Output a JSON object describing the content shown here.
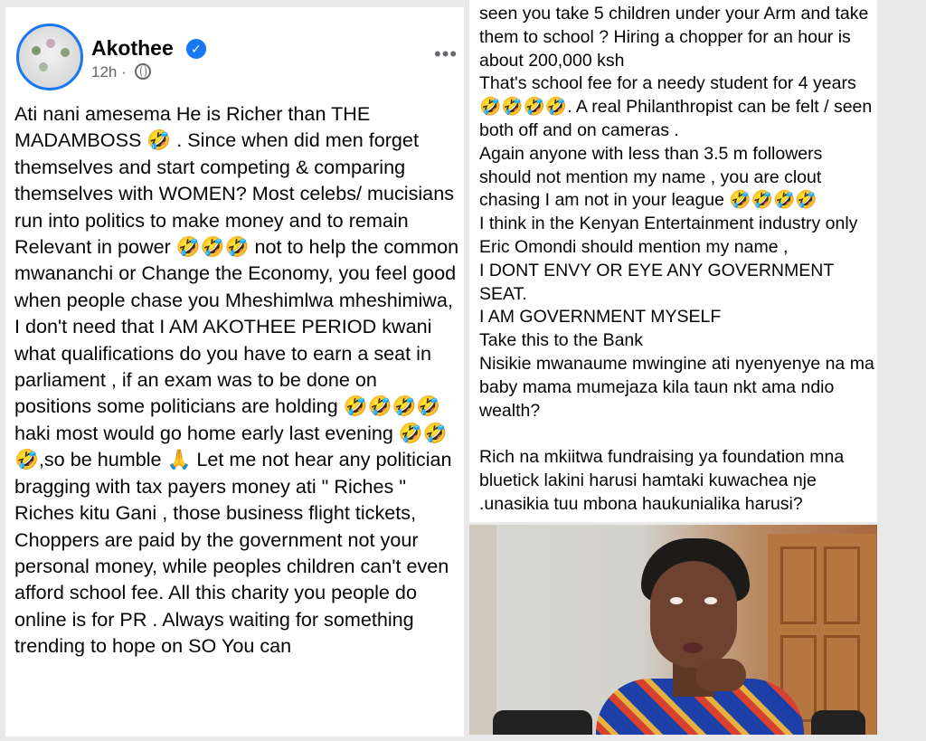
{
  "post": {
    "author": "Akothee",
    "time": "12h",
    "separator": "·",
    "more_label": "•••",
    "verified_mark": "✓",
    "text_left": "Ati nani amesema He is Richer than THE MADAMBOSS 🤣 . Since when did men forget themselves and start competing  & comparing themselves with WOMEN? Most celebs/ mucisians  run into politics to make money and to remain  Relevant in power 🤣🤣🤣  not to help the common mwananchi or Change the Economy, you feel good when people chase you Mheshimlwa mheshimiwa, I don't need that I AM AKOTHEE PERIOD kwani what qualifications do you have to earn a seat in parliament , if an exam was to be done on positions some politicians are holding 🤣🤣🤣🤣haki most would go home early last evening 🤣🤣🤣,so be humble 🙏 Let me not hear any politician bragging with tax payers money ati \"  Riches \"  Riches kitu Gani , those business flight tickets, Choppers  are paid by the government not your personal money, while peoples children can't even afford school fee. All this charity you people do online is for PR . Always waiting for something trending to hope on SO You can",
    "text_right": "seen you take 5 children under your Arm and take them to school ? Hiring a chopper for an hour is about 200,000 ksh\nThat's school fee for a needy student for 4 years 🤣🤣🤣🤣. A real Philanthropist can be felt / seen both off and on cameras .\nAgain anyone with less than 3.5 m followers should not mention my name , you are clout chasing I am not in your league 🤣🤣🤣🤣\nI think in the Kenyan Entertainment industry only Eric Omondi should mention my name ,\nI DONT ENVY OR EYE ANY GOVERNMENT SEAT.\nI AM GOVERNMENT MYSELF\nTake this to the Bank\nNisikie mwanaume mwingine ati nyenyenye na ma baby mama mumejaza kila taun nkt ama ndio wealth?\n\nRich na mkiitwa fundraising ya foundation mna bluetick lakini harusi hamtaki kuwachea nje .unasikia tuu mbona haukunialika harusi?"
  },
  "icons": {
    "verified": "verified-badge-icon",
    "audience": "globe-icon",
    "more": "more-options-icon"
  },
  "colors": {
    "accent": "#1877f2",
    "meta": "#65676b",
    "text": "#050505"
  }
}
